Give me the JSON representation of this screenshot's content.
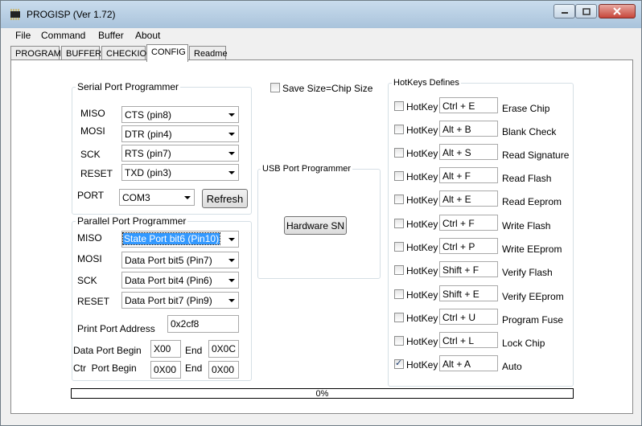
{
  "window": {
    "title": "PROGISP (Ver 1.72)"
  },
  "menu": [
    "File",
    "Command",
    "Buffer",
    "About"
  ],
  "tabs": [
    "PROGRAM",
    "BUFFER",
    "CHECKIO",
    "CONFIG",
    "Readme"
  ],
  "active_tab": "CONFIG",
  "serial": {
    "title": "Serial Port Programmer",
    "rows": [
      {
        "label": "MISO",
        "value": "CTS (pin8)"
      },
      {
        "label": "MOSI",
        "value": "DTR (pin4)"
      },
      {
        "label": "SCK",
        "value": "RTS (pin7)"
      },
      {
        "label": "RESET",
        "value": "TXD (pin3)"
      }
    ],
    "port_label": "PORT",
    "port_value": "COM3",
    "refresh": "Refresh"
  },
  "parallel": {
    "title": "Parallel Port Programmer",
    "rows": [
      {
        "label": "MISO",
        "value": "State Port bit6 (Pin10)"
      },
      {
        "label": "MOSI",
        "value": "Data Port bit5 (Pin7)"
      },
      {
        "label": "SCK",
        "value": "Data Port bit4 (Pin6)"
      },
      {
        "label": "RESET",
        "value": "Data Port bit7 (Pin9)"
      }
    ],
    "print_port_label": "Print Port Address",
    "print_port_value": "0x2cf8",
    "data_port_begin_label": "Data Port Begin",
    "data_port_begin_value": "X00",
    "data_port_end_label": "End",
    "data_port_end_value": "0X0C",
    "ctr_port_begin_label": "Ctr  Port Begin",
    "ctr_port_begin_value": "0X00",
    "ctr_port_end_label": "End",
    "ctr_port_end_value": "0X00"
  },
  "save_size": {
    "label": "Save Size=Chip Size",
    "checked": false
  },
  "usb": {
    "title": "USB Port Programmer",
    "button": "Hardware SN"
  },
  "hotkeys": {
    "title": "HotKeys Defines",
    "checkbox_label": "HotKey",
    "items": [
      {
        "key": "Ctrl + E",
        "action": "Erase Chip",
        "checked": false
      },
      {
        "key": "Alt + B",
        "action": "Blank Check",
        "checked": false
      },
      {
        "key": "Alt + S",
        "action": "Read Signature",
        "checked": false
      },
      {
        "key": "Alt + F",
        "action": "Read Flash",
        "checked": false
      },
      {
        "key": "Alt + E",
        "action": "Read Eeprom",
        "checked": false
      },
      {
        "key": "Ctrl + F",
        "action": "Write Flash",
        "checked": false
      },
      {
        "key": "Ctrl + P",
        "action": "Write EEprom",
        "checked": false
      },
      {
        "key": "Shift + F",
        "action": "Verify Flash",
        "checked": false
      },
      {
        "key": "Shift + E",
        "action": "Verify EEprom",
        "checked": false
      },
      {
        "key": "Ctrl + U",
        "action": "Program Fuse",
        "checked": false
      },
      {
        "key": "Ctrl + L",
        "action": "Lock Chip",
        "checked": false
      },
      {
        "key": "Alt + A",
        "action": "Auto",
        "checked": true
      }
    ]
  },
  "progress": {
    "text": "0%",
    "fraction": 0
  }
}
